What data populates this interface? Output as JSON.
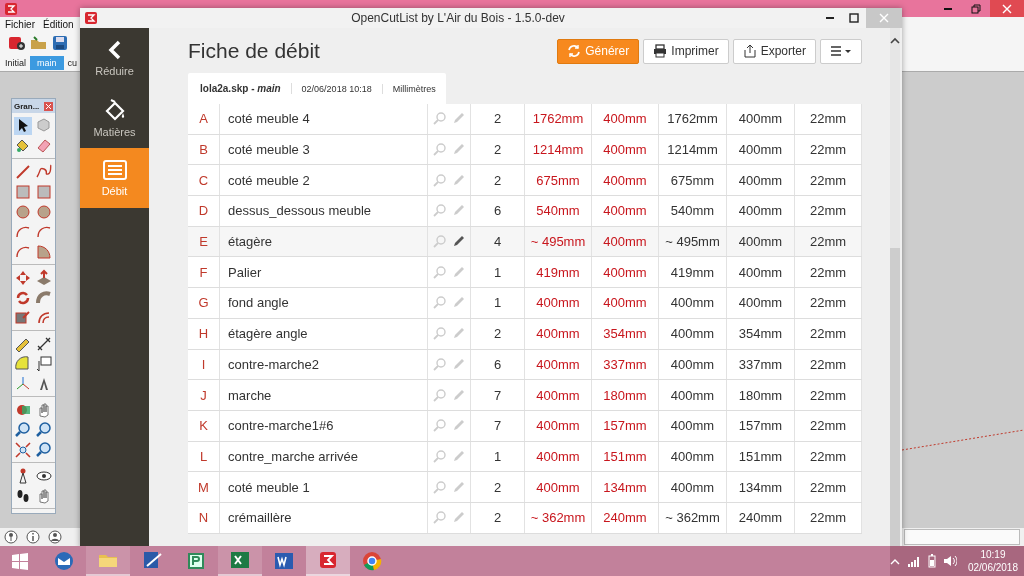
{
  "sketchup": {
    "menu": [
      {
        "label": "Fichier"
      },
      {
        "label": "Édition"
      }
    ],
    "scene_tabs": [
      {
        "label": "Initial",
        "selected": false
      },
      {
        "label": "main",
        "selected": true
      },
      {
        "label": "cu",
        "selected": false
      }
    ],
    "tool_palette": {
      "title": "Gran...",
      "groups": [
        [
          {
            "kind": "select",
            "selected": true
          },
          {
            "kind": "component",
            "selected": false
          },
          {
            "kind": "paint",
            "selected": false
          },
          {
            "kind": "eraser",
            "selected": false
          }
        ],
        [
          {
            "kind": "line",
            "selected": false
          },
          {
            "kind": "freehand",
            "selected": false
          },
          {
            "kind": "rectangle",
            "selected": false
          },
          {
            "kind": "rectangle",
            "selected": false
          },
          {
            "kind": "circle",
            "selected": false
          },
          {
            "kind": "circle",
            "selected": false
          },
          {
            "kind": "arc",
            "selected": false
          },
          {
            "kind": "arc",
            "selected": false
          },
          {
            "kind": "arc",
            "selected": false
          },
          {
            "kind": "pie",
            "selected": false
          }
        ],
        [
          {
            "kind": "move",
            "selected": false
          },
          {
            "kind": "pushpull",
            "selected": false
          },
          {
            "kind": "rotate",
            "selected": false
          },
          {
            "kind": "followme",
            "selected": false
          },
          {
            "kind": "scale",
            "selected": false
          },
          {
            "kind": "offset",
            "selected": false
          }
        ],
        [
          {
            "kind": "tape",
            "selected": false
          },
          {
            "kind": "dimension",
            "selected": false
          },
          {
            "kind": "protractor",
            "selected": false
          },
          {
            "kind": "text",
            "selected": false
          },
          {
            "kind": "axes",
            "selected": false
          },
          {
            "kind": "text3d",
            "selected": false
          }
        ],
        [
          {
            "kind": "section",
            "selected": false
          },
          {
            "kind": "pan",
            "selected": false
          },
          {
            "kind": "zoom",
            "selected": false
          },
          {
            "kind": "zoom",
            "selected": false
          },
          {
            "kind": "zoomextents",
            "selected": false
          },
          {
            "kind": "zoom",
            "selected": false
          }
        ],
        [
          {
            "kind": "position",
            "selected": false
          },
          {
            "kind": "lookaround",
            "selected": false
          },
          {
            "kind": "walk",
            "selected": false
          },
          {
            "kind": "pan",
            "selected": false
          }
        ]
      ]
    }
  },
  "window": {
    "title": "OpenCutList by L'Air du Bois - 1.5.0-dev"
  },
  "sidebar": {
    "items": [
      {
        "label": "Réduire",
        "kind": "collapse",
        "selected": false
      },
      {
        "label": "Matières",
        "kind": "materials",
        "selected": false
      },
      {
        "label": "Débit",
        "kind": "cutlist",
        "selected": true
      }
    ]
  },
  "header": {
    "title": "Fiche de débit",
    "buttons": [
      {
        "label": "Générer",
        "kind": "refresh",
        "primary": true
      },
      {
        "label": "Imprimer",
        "kind": "print",
        "primary": false
      },
      {
        "label": "Exporter",
        "kind": "export",
        "primary": false
      }
    ]
  },
  "info_tab": {
    "file": "lola2a.skp - *main*",
    "date": "02/06/2018 10:18",
    "unit": "Millimètres"
  },
  "table": {
    "rows": [
      {
        "cells": [
          "A",
          "coté meuble 4",
          "2",
          "1762mm",
          "400mm",
          "1762mm",
          "400mm",
          "22mm"
        ],
        "highlighted": false
      },
      {
        "cells": [
          "B",
          "coté meuble 3",
          "2",
          "1214mm",
          "400mm",
          "1214mm",
          "400mm",
          "22mm"
        ],
        "highlighted": false
      },
      {
        "cells": [
          "C",
          "coté meuble 2",
          "2",
          "675mm",
          "400mm",
          "675mm",
          "400mm",
          "22mm"
        ],
        "highlighted": false
      },
      {
        "cells": [
          "D",
          "dessus_dessous meuble",
          "6",
          "540mm",
          "400mm",
          "540mm",
          "400mm",
          "22mm"
        ],
        "highlighted": false
      },
      {
        "cells": [
          "E",
          "étagère",
          "4",
          "~ 495mm",
          "400mm",
          "~ 495mm",
          "400mm",
          "22mm"
        ],
        "highlighted": true
      },
      {
        "cells": [
          "F",
          "Palier",
          "1",
          "419mm",
          "400mm",
          "419mm",
          "400mm",
          "22mm"
        ],
        "highlighted": false
      },
      {
        "cells": [
          "G",
          "fond angle",
          "1",
          "400mm",
          "400mm",
          "400mm",
          "400mm",
          "22mm"
        ],
        "highlighted": false
      },
      {
        "cells": [
          "H",
          "étagère angle",
          "2",
          "400mm",
          "354mm",
          "400mm",
          "354mm",
          "22mm"
        ],
        "highlighted": false
      },
      {
        "cells": [
          "I",
          "contre-marche2",
          "6",
          "400mm",
          "337mm",
          "400mm",
          "337mm",
          "22mm"
        ],
        "highlighted": false
      },
      {
        "cells": [
          "J",
          "marche",
          "7",
          "400mm",
          "180mm",
          "400mm",
          "180mm",
          "22mm"
        ],
        "highlighted": false
      },
      {
        "cells": [
          "K",
          "contre-marche1#6",
          "7",
          "400mm",
          "157mm",
          "400mm",
          "157mm",
          "22mm"
        ],
        "highlighted": false
      },
      {
        "cells": [
          "L",
          "contre_marche arrivée",
          "1",
          "400mm",
          "151mm",
          "400mm",
          "151mm",
          "22mm"
        ],
        "highlighted": false
      },
      {
        "cells": [
          "M",
          "coté meuble 1",
          "2",
          "400mm",
          "134mm",
          "400mm",
          "134mm",
          "22mm"
        ],
        "highlighted": false
      },
      {
        "cells": [
          "N",
          "crémaillère",
          "2",
          "~ 362mm",
          "240mm",
          "~ 362mm",
          "240mm",
          "22mm"
        ],
        "highlighted": false
      }
    ]
  },
  "taskbar": {
    "apps": [
      {
        "kind": "mail",
        "running": false,
        "selected": false
      },
      {
        "kind": "folder",
        "running": true,
        "selected": false
      },
      {
        "kind": "drawing",
        "running": false,
        "selected": false
      },
      {
        "kind": "project",
        "running": false,
        "selected": false
      },
      {
        "kind": "excel",
        "running": true,
        "selected": false
      },
      {
        "kind": "word",
        "running": false,
        "selected": false
      },
      {
        "kind": "sketchup",
        "running": true,
        "selected": true
      },
      {
        "kind": "browser",
        "running": false,
        "selected": false
      }
    ],
    "time": "10:19",
    "date": "02/06/2018"
  }
}
